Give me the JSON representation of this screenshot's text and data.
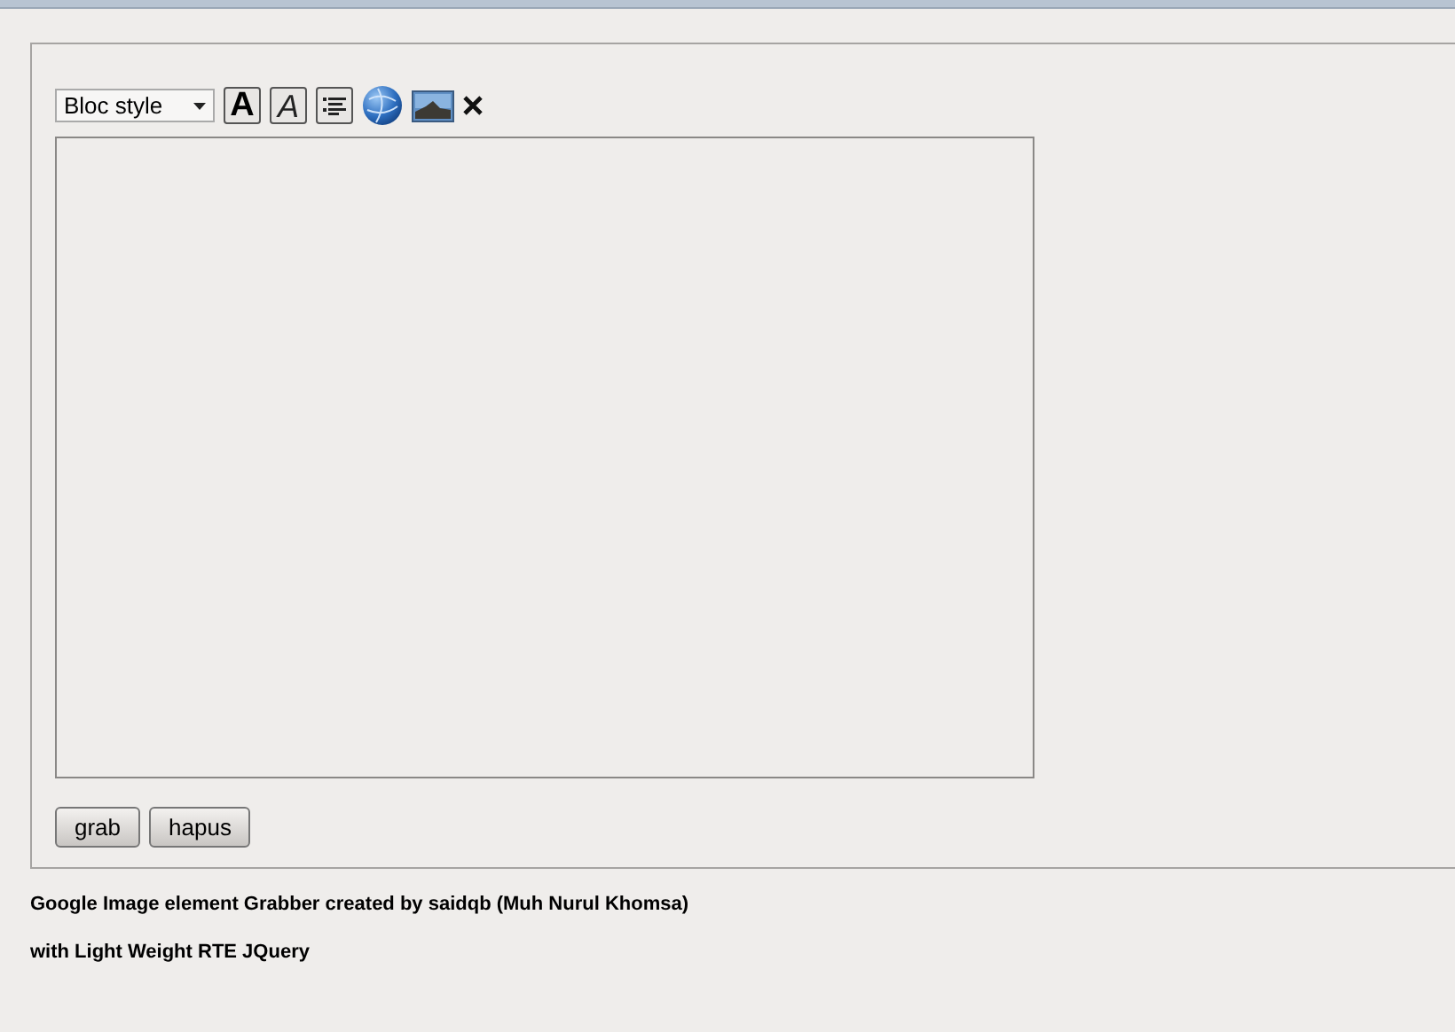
{
  "editor": {
    "style_select": {
      "value": "Bloc style"
    },
    "toolbar": [
      {
        "kind": "bold",
        "label": "A"
      },
      {
        "kind": "italic",
        "label": "A"
      },
      {
        "kind": "list"
      },
      {
        "kind": "link"
      },
      {
        "kind": "image"
      },
      {
        "kind": "remove"
      }
    ]
  },
  "buttons": [
    "grab",
    "hapus"
  ],
  "footer": [
    "Google Image element Grabber created by saidqb (Muh Nurul Khomsa)",
    "with Light Weight RTE JQuery"
  ]
}
